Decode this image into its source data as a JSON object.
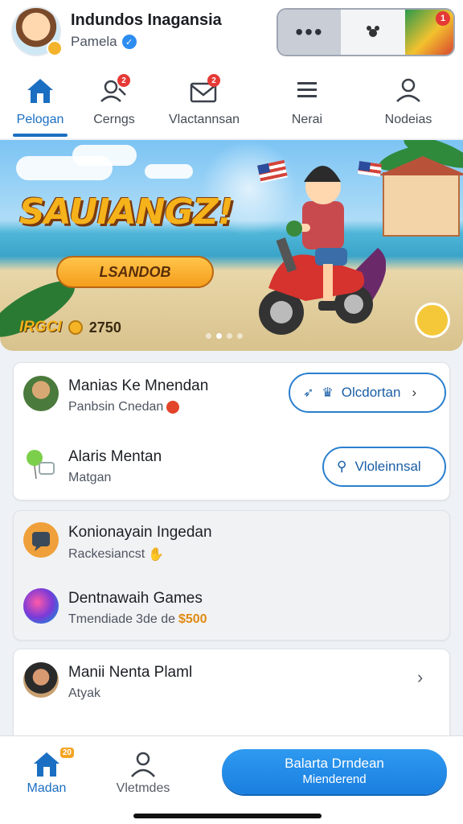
{
  "header": {
    "title": "Indundos Inagansia",
    "subtitle": "Pamela",
    "controls": {
      "more_icon": "more-icon",
      "target_icon": "target-icon",
      "game_badge": "1"
    }
  },
  "tabs": [
    {
      "label": "Pelogan",
      "icon": "home-icon",
      "active": true,
      "badge": ""
    },
    {
      "label": "Cerngs",
      "icon": "users-icon",
      "badge": "2"
    },
    {
      "label": "Vlactannsan",
      "icon": "mail-icon",
      "badge": "2"
    },
    {
      "label": "Nerai",
      "icon": "menu-icon",
      "badge": ""
    },
    {
      "label": "Nodeias",
      "icon": "profile-icon",
      "badge": ""
    }
  ],
  "banner": {
    "title": "SAUIANGZ!",
    "button": "LSANDOB",
    "score_label": "IRGCI",
    "score_value": "2750"
  },
  "card1": {
    "item1": {
      "title": "Manias Ke Mnendan",
      "subtitle": "Panbsin Cnedan",
      "action": "Olcdortan"
    },
    "item2": {
      "title": "Alaris Mentan",
      "subtitle": "Matgan",
      "action": "Vloleinnsal"
    }
  },
  "card2": {
    "item1": {
      "title": "Konionayain Ingedan",
      "subtitle": "Rackesiancst"
    },
    "item2": {
      "title": "Dentnawaih Games",
      "subtitle_prefix": "Tmendiade",
      "subtitle_mid": "3de de",
      "subtitle_amount": "$500"
    }
  },
  "card3": {
    "item1": {
      "title": "Manii Nenta Plaml",
      "subtitle": "Atyak"
    }
  },
  "bottom_nav": {
    "home": {
      "label": "Madan",
      "badge": "20"
    },
    "profile": {
      "label": "Vletmdes"
    },
    "cta_line1": "Balarta Drndean",
    "cta_line2": "Mienderend"
  },
  "colors": {
    "accent": "#1b6fc2",
    "badge": "#e53935",
    "gold": "#f6b21a"
  }
}
